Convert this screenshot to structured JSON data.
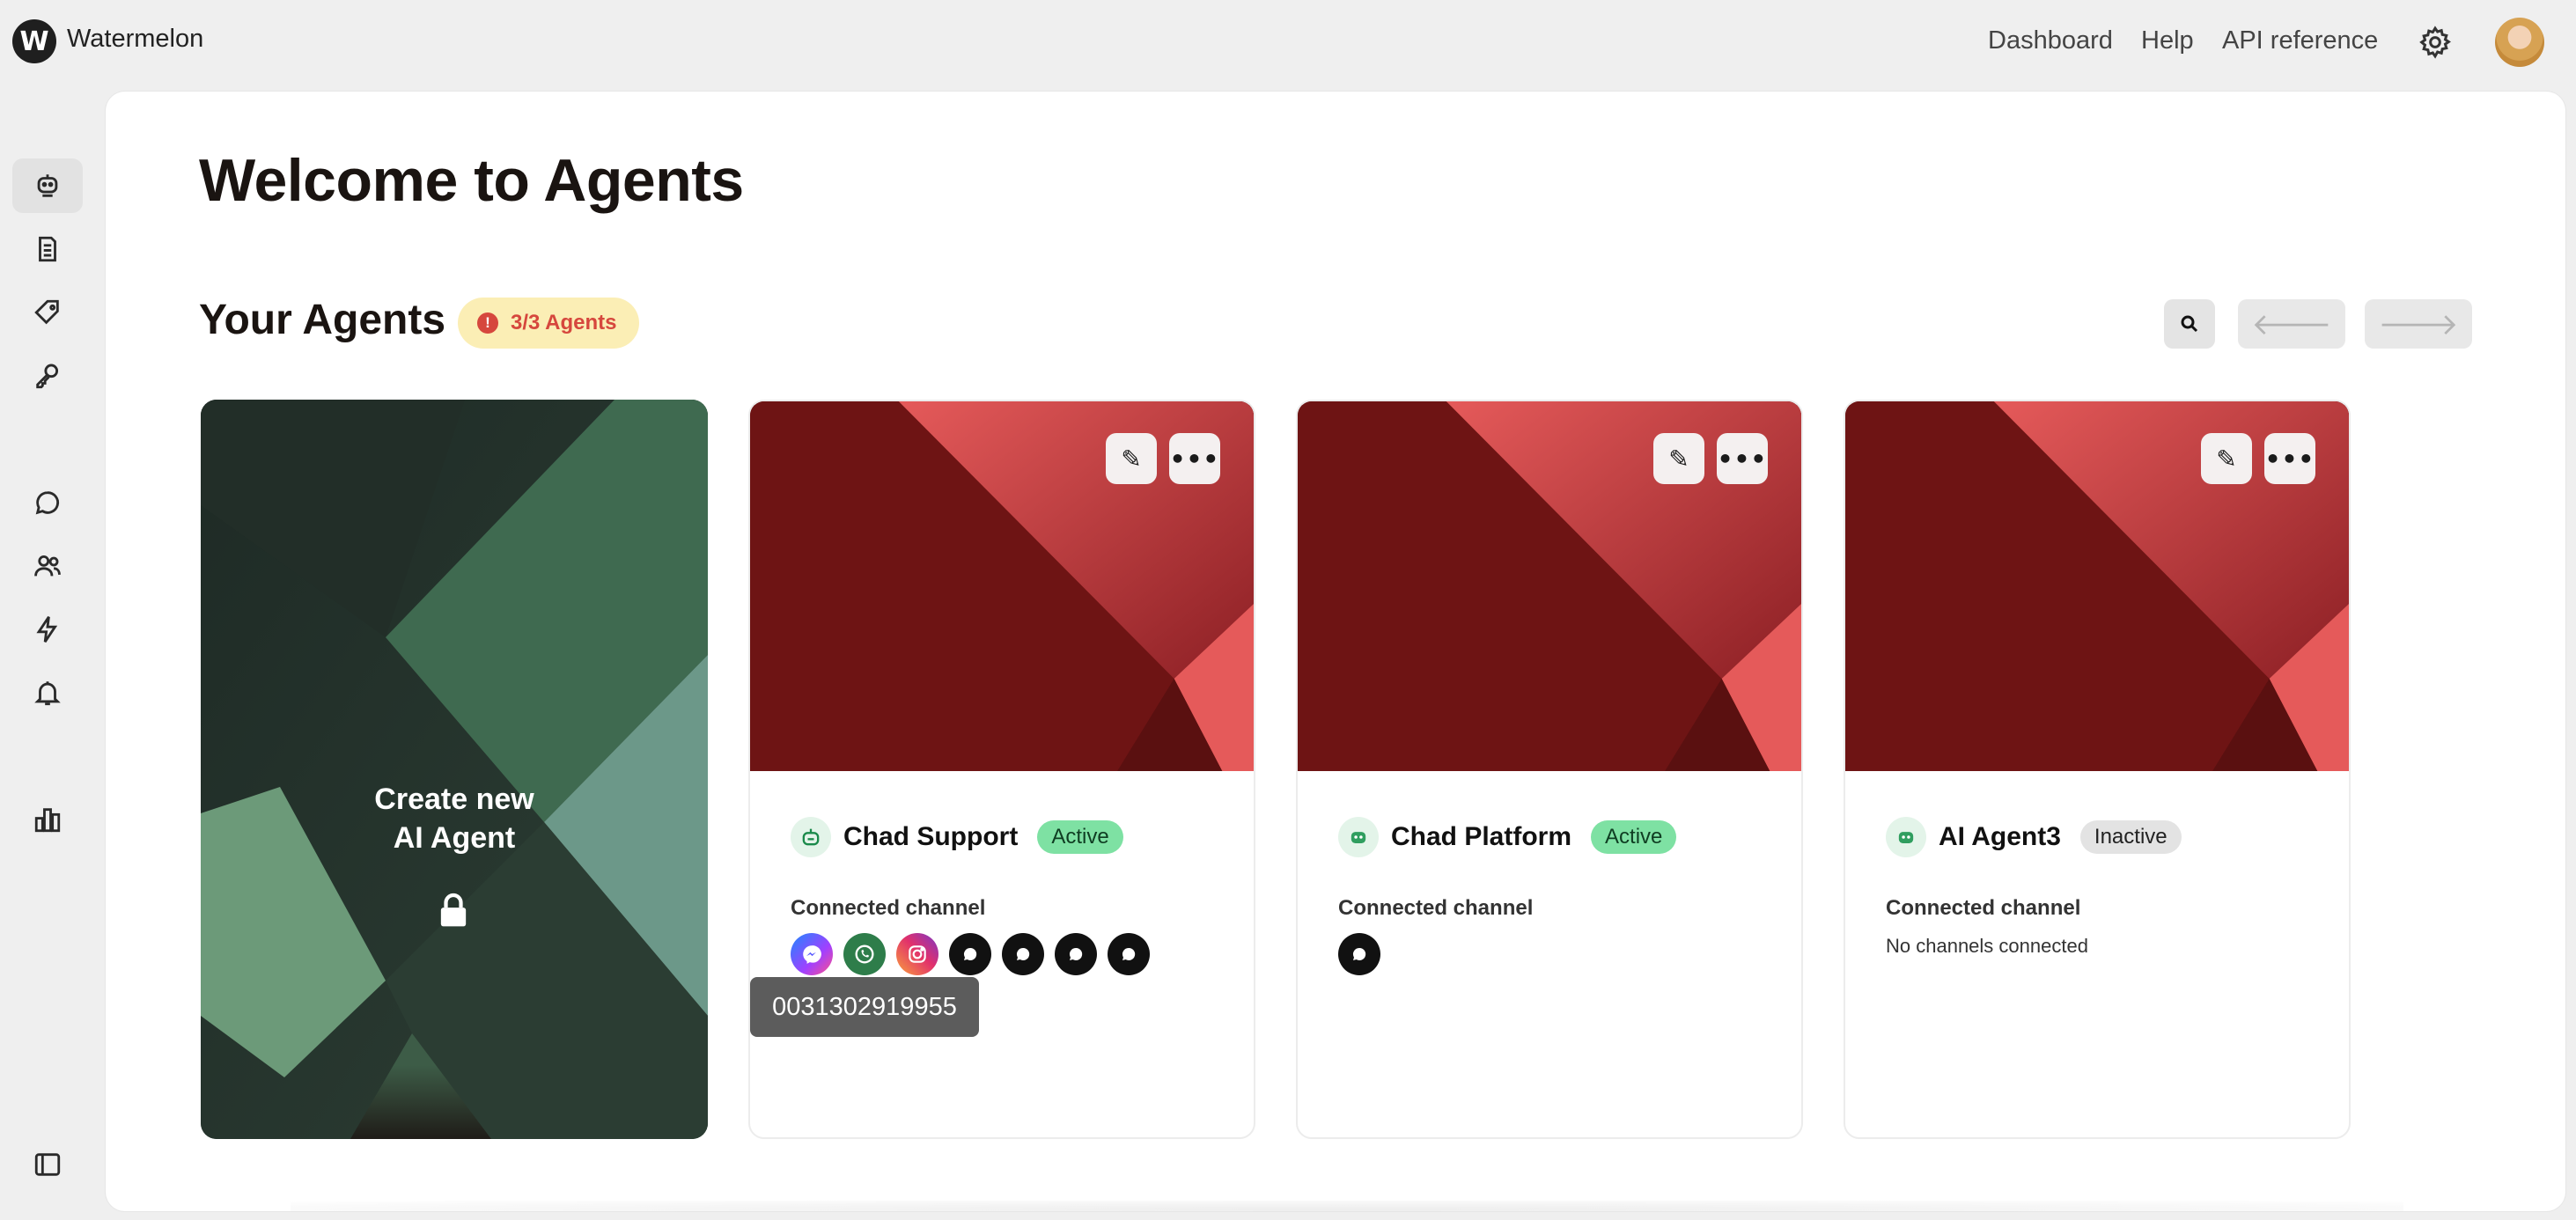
{
  "app": {
    "logo_letter": "W",
    "brand": "Watermelon"
  },
  "topnav": {
    "dashboard": "Dashboard",
    "help": "Help",
    "api_reference": "API reference"
  },
  "sidebar": {
    "items": [
      {
        "name": "agents",
        "icon": "robot-icon",
        "active": true
      },
      {
        "name": "documents",
        "icon": "document-icon",
        "active": false
      },
      {
        "name": "tags",
        "icon": "tag-icon",
        "active": false
      },
      {
        "name": "keys",
        "icon": "key-icon",
        "active": false
      },
      {
        "name": "conversations",
        "icon": "chat-bubble-icon",
        "active": false
      },
      {
        "name": "users",
        "icon": "users-icon",
        "active": false
      },
      {
        "name": "automations",
        "icon": "lightning-icon",
        "active": false
      },
      {
        "name": "notifications",
        "icon": "bell-icon",
        "active": false
      },
      {
        "name": "analytics",
        "icon": "bar-chart-icon",
        "active": false
      },
      {
        "name": "toggle-sidebar",
        "icon": "sidebar-toggle-icon",
        "active": false
      }
    ]
  },
  "main": {
    "title": "Welcome to Agents",
    "section_title": "Your Agents",
    "quota_badge": "3/3 Agents",
    "quota_icon": "!",
    "create_card": {
      "line1": "Create new",
      "line2": "AI Agent"
    },
    "agents": [
      {
        "name": "Chad Support",
        "status": "Active",
        "connected_label": "Connected channel"
      },
      {
        "name": "Chad Platform",
        "status": "Active",
        "connected_label": "Connected channel"
      },
      {
        "name": "AI Agent3",
        "status": "Inactive",
        "connected_label": "Connected channel",
        "no_channels": "No channels connected"
      }
    ],
    "tooltip": "0031302919955"
  },
  "colors": {
    "accent_red": "#701414",
    "active_green": "#7ee1a3",
    "badge_yellow": "#fbeeb5",
    "badge_text": "#d6473d"
  }
}
